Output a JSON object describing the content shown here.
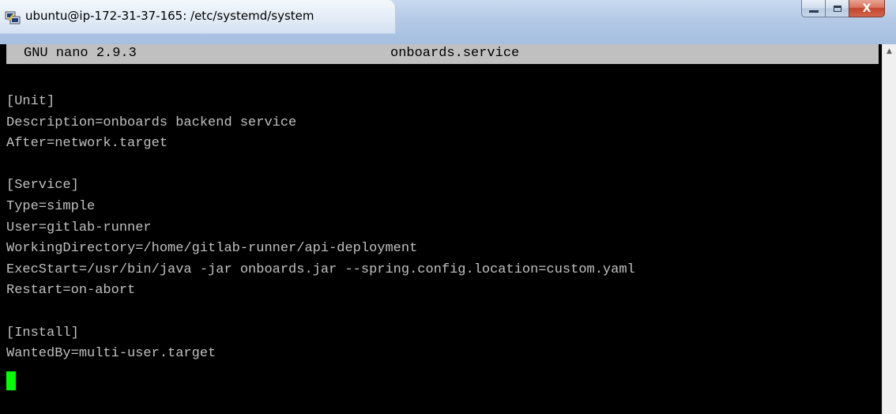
{
  "window": {
    "title": "ubuntu@ip-172-31-37-165: /etc/systemd/system",
    "icons": {
      "app": "putty-icon",
      "minimize": "minimize-icon",
      "maximize": "maximize-icon",
      "close": "close-icon",
      "scroll_up": "scroll-up-arrow-icon"
    },
    "close_label": "X"
  },
  "nano": {
    "version_label": "GNU nano 2.9.3",
    "filename": "onboards.service"
  },
  "file_lines": [
    "[Unit]",
    "Description=onboards backend service",
    "After=network.target",
    "",
    "[Service]",
    "Type=simple",
    "User=gitlab-runner",
    "WorkingDirectory=/home/gitlab-runner/api-deployment",
    "ExecStart=/usr/bin/java -jar onboards.jar --spring.config.location=custom.yaml",
    "Restart=on-abort",
    "",
    "[Install]",
    "WantedBy=multi-user.target"
  ],
  "colors": {
    "terminal_bg": "#000000",
    "terminal_fg": "#c0c0c0",
    "header_bg": "#c0c0c0",
    "cursor": "#00ff00"
  }
}
